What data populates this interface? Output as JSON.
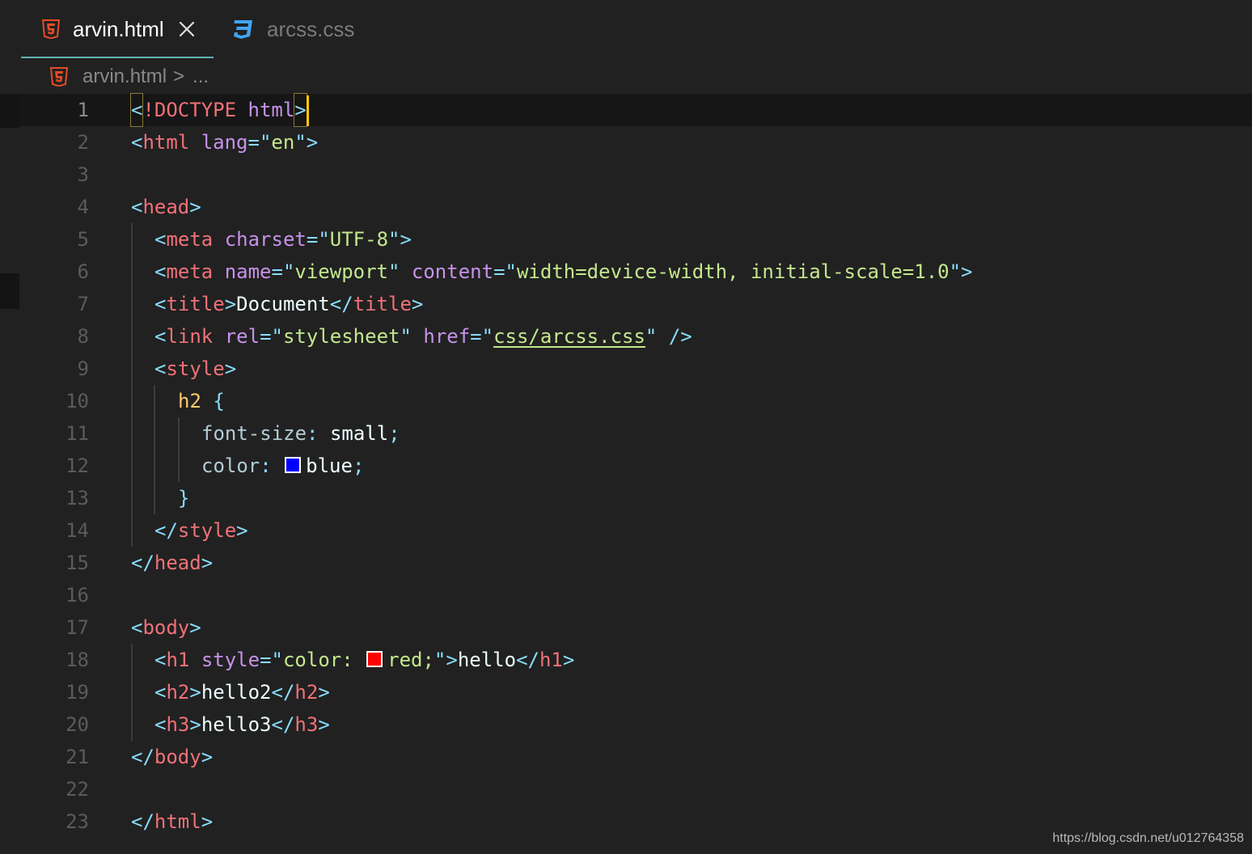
{
  "tabs": [
    {
      "label": "arvin.html",
      "icon": "html5-icon",
      "active": true
    },
    {
      "label": "arcss.css",
      "icon": "css3-icon",
      "active": false
    }
  ],
  "breadcrumb": {
    "file": "arvin.html",
    "separator": ">",
    "more": "..."
  },
  "editor": {
    "line_numbers": [
      "1",
      "2",
      "3",
      "4",
      "5",
      "6",
      "7",
      "8",
      "9",
      "10",
      "11",
      "12",
      "13",
      "14",
      "15",
      "16",
      "17",
      "18",
      "19",
      "20",
      "21",
      "22",
      "23"
    ],
    "code": {
      "l1": {
        "open": "<",
        "doctype": "!DOCTYPE",
        "sp": " ",
        "html": "html",
        "close": ">"
      },
      "l2": {
        "open": "<",
        "tag": "html",
        "sp": " ",
        "attr": "lang",
        "eq": "=",
        "q1": "\"",
        "val": "en",
        "q2": "\"",
        "close": ">"
      },
      "l4": {
        "open": "<",
        "tag": "head",
        "close": ">"
      },
      "l5": {
        "open": "<",
        "tag": "meta",
        "sp": " ",
        "attr": "charset",
        "eq": "=",
        "q1": "\"",
        "val": "UTF-8",
        "q2": "\"",
        "close": ">"
      },
      "l6": {
        "open": "<",
        "tag": "meta",
        "sp": " ",
        "attr1": "name",
        "eq1": "=",
        "q1": "\"",
        "val1": "viewport",
        "q2": "\"",
        "sp2": " ",
        "attr2": "content",
        "eq2": "=",
        "q3": "\"",
        "val2": "width=device-width, initial-scale=1.0",
        "q4": "\"",
        "close": ">"
      },
      "l7": {
        "open": "<",
        "tag": "title",
        "close": ">",
        "text": "Document",
        "open2": "</",
        "tag2": "title",
        "close2": ">"
      },
      "l8": {
        "open": "<",
        "tag": "link",
        "sp": " ",
        "attr1": "rel",
        "eq1": "=",
        "q1": "\"",
        "val1": "stylesheet",
        "q2": "\"",
        "sp2": " ",
        "attr2": "href",
        "eq2": "=",
        "q3": "\"",
        "val2": "css/arcss.css",
        "q4": "\"",
        "close": " />"
      },
      "l9": {
        "open": "<",
        "tag": "style",
        "close": ">"
      },
      "l10": {
        "selector": "h2",
        "sp": " ",
        "brace": "{"
      },
      "l11": {
        "prop": "font-size",
        "colon": ": ",
        "value": "small",
        "semi": ";"
      },
      "l12": {
        "prop": "color",
        "colon": ": ",
        "value": "blue",
        "semi": ";",
        "swatch_color": "#0000ff"
      },
      "l13": {
        "brace": "}"
      },
      "l14": {
        "open": "</",
        "tag": "style",
        "close": ">"
      },
      "l15": {
        "open": "</",
        "tag": "head",
        "close": ">"
      },
      "l17": {
        "open": "<",
        "tag": "body",
        "close": ">"
      },
      "l18": {
        "open": "<",
        "tag": "h1",
        "sp": " ",
        "attr": "style",
        "eq": "=",
        "q1": "\"",
        "val1": "color: ",
        "val2": "red;",
        "q2": "\"",
        "close": ">",
        "text": "hello",
        "open2": "</",
        "tag2": "h1",
        "close2": ">",
        "swatch_color": "#ff0000"
      },
      "l19": {
        "open": "<",
        "tag": "h2",
        "close": ">",
        "text": "hello2",
        "open2": "</",
        "tag2": "h2",
        "close2": ">"
      },
      "l20": {
        "open": "<",
        "tag": "h3",
        "close": ">",
        "text": "hello3",
        "open2": "</",
        "tag2": "h3",
        "close2": ">"
      },
      "l21": {
        "open": "</",
        "tag": "body",
        "close": ">"
      },
      "l23": {
        "open": "</",
        "tag": "html",
        "close": ">"
      }
    }
  },
  "watermark": "https://blog.csdn.net/u012764358",
  "colors": {
    "background": "#212121",
    "tab_underline": "#5fb3ad",
    "tag": "#f07178",
    "punctuation": "#89ddff",
    "attribute": "#c792ea",
    "string": "#c3e88d",
    "selector": "#ffcb6b",
    "cursor": "#ffcc00",
    "html5_icon": "#e44d26",
    "css3_icon": "#42a5f5"
  }
}
